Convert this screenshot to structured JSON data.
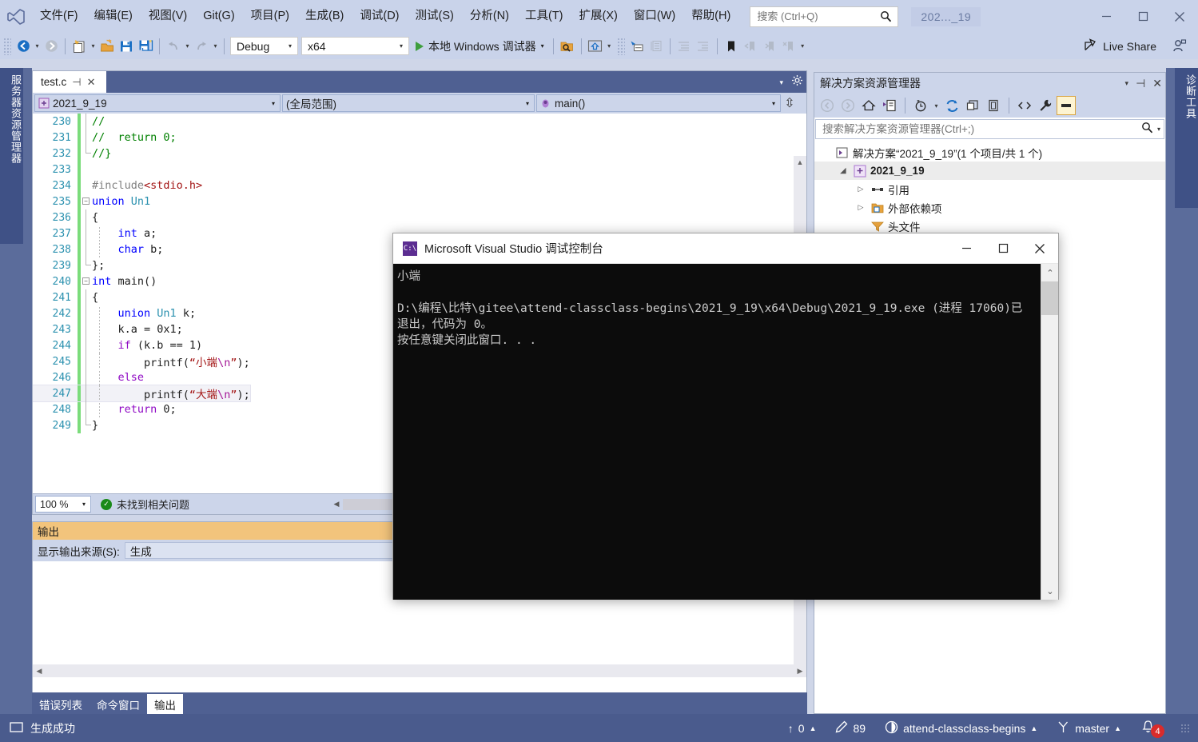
{
  "titlebar": {
    "menu": [
      {
        "label": "文件(F)"
      },
      {
        "label": "编辑(E)"
      },
      {
        "label": "视图(V)"
      },
      {
        "label": "Git(G)"
      },
      {
        "label": "项目(P)"
      },
      {
        "label": "生成(B)"
      },
      {
        "label": "调试(D)"
      },
      {
        "label": "测试(S)"
      },
      {
        "label": "分析(N)"
      },
      {
        "label": "工具(T)"
      },
      {
        "label": "扩展(X)"
      },
      {
        "label": "窗口(W)"
      },
      {
        "label": "帮助(H)"
      }
    ],
    "search_placeholder": "搜索 (Ctrl+Q)",
    "window_name": "202..._19",
    "minimize": "—",
    "maximize": "▢",
    "close": "✕"
  },
  "toolbar": {
    "config": "Debug",
    "platform": "x64",
    "run_label": "本地 Windows 调试器",
    "live_share": "Live Share"
  },
  "left_rail": {
    "label": "服务器资源管理器"
  },
  "right_rail": {
    "label": "诊断工具"
  },
  "editor": {
    "tab_name": "test.c",
    "tab_pin": "⊣",
    "tab_close": "✕",
    "nav_project": "2021_9_19",
    "nav_scope": "(全局范围)",
    "nav_member": "main()",
    "zoom_level": "100 %",
    "issues_status": "未找到相关问题",
    "lines": [
      {
        "n": "230",
        "indent": 1,
        "tokens": [
          {
            "t": "//",
            "c": "c-comment"
          }
        ],
        "guide": "mid"
      },
      {
        "n": "231",
        "indent": 1,
        "tokens": [
          {
            "t": "//  return 0;",
            "c": "c-comment"
          }
        ],
        "guide": "mid"
      },
      {
        "n": "232",
        "indent": 1,
        "tokens": [
          {
            "t": "//}",
            "c": "c-comment"
          }
        ],
        "guide": "end"
      },
      {
        "n": "233",
        "indent": 0,
        "tokens": []
      },
      {
        "n": "234",
        "indent": 1,
        "tokens": [
          {
            "t": "#include",
            "c": "c-pp"
          },
          {
            "t": "<stdio.h>",
            "c": "c-str"
          }
        ]
      },
      {
        "n": "235",
        "indent": 0,
        "fold": "−",
        "tokens": [
          {
            "t": "union ",
            "c": "c-kw"
          },
          {
            "t": "Un1",
            "c": "c-type"
          }
        ]
      },
      {
        "n": "236",
        "indent": 1,
        "tokens": [
          {
            "t": "{",
            "c": "c-plain"
          }
        ],
        "guide": "mid"
      },
      {
        "n": "237",
        "indent": 1,
        "tokens": [
          {
            "t": "    ",
            "c": "c-plain"
          },
          {
            "t": "int",
            "c": "c-kw"
          },
          {
            "t": " a;",
            "c": "c-plain"
          }
        ],
        "guide": "mid",
        "inner": true
      },
      {
        "n": "238",
        "indent": 1,
        "tokens": [
          {
            "t": "    ",
            "c": "c-plain"
          },
          {
            "t": "char",
            "c": "c-kw"
          },
          {
            "t": " b;",
            "c": "c-plain"
          }
        ],
        "guide": "mid",
        "inner": true
      },
      {
        "n": "239",
        "indent": 1,
        "tokens": [
          {
            "t": "};",
            "c": "c-plain"
          }
        ],
        "guide": "end"
      },
      {
        "n": "240",
        "indent": 0,
        "fold": "−",
        "tokens": [
          {
            "t": "int",
            "c": "c-kw"
          },
          {
            "t": " main()",
            "c": "c-plain"
          }
        ]
      },
      {
        "n": "241",
        "indent": 1,
        "tokens": [
          {
            "t": "{",
            "c": "c-plain"
          }
        ],
        "guide": "mid"
      },
      {
        "n": "242",
        "indent": 1,
        "tokens": [
          {
            "t": "    ",
            "c": "c-plain"
          },
          {
            "t": "union",
            "c": "c-kw"
          },
          {
            "t": " ",
            "c": "c-plain"
          },
          {
            "t": "Un1",
            "c": "c-type"
          },
          {
            "t": " k;",
            "c": "c-plain"
          }
        ],
        "guide": "mid",
        "inner": true
      },
      {
        "n": "243",
        "indent": 1,
        "tokens": [
          {
            "t": "    k.a = 0x1;",
            "c": "c-plain"
          }
        ],
        "guide": "mid",
        "inner": true
      },
      {
        "n": "244",
        "indent": 1,
        "tokens": [
          {
            "t": "    ",
            "c": "c-plain"
          },
          {
            "t": "if",
            "c": "c-ctl"
          },
          {
            "t": " (k.b == 1)",
            "c": "c-plain"
          }
        ],
        "guide": "mid",
        "inner": true
      },
      {
        "n": "245",
        "indent": 1,
        "tokens": [
          {
            "t": "        printf(",
            "c": "c-plain"
          },
          {
            "t": "“小端",
            "c": "c-str"
          },
          {
            "t": "\\n",
            "c": "c-esc"
          },
          {
            "t": "”",
            "c": "c-str"
          },
          {
            "t": ");",
            "c": "c-plain"
          }
        ],
        "guide": "mid",
        "inner": true
      },
      {
        "n": "246",
        "indent": 1,
        "tokens": [
          {
            "t": "    ",
            "c": "c-plain"
          },
          {
            "t": "else",
            "c": "c-ctl"
          }
        ],
        "guide": "mid",
        "inner": true
      },
      {
        "n": "247",
        "indent": 1,
        "highlight": true,
        "tokens": [
          {
            "t": "        printf(",
            "c": "c-plain"
          },
          {
            "t": "“大端",
            "c": "c-str"
          },
          {
            "t": "\\n",
            "c": "c-esc"
          },
          {
            "t": "”",
            "c": "c-str"
          },
          {
            "t": ");",
            "c": "c-plain"
          }
        ],
        "guide": "mid",
        "inner": true
      },
      {
        "n": "248",
        "indent": 1,
        "tokens": [
          {
            "t": "    ",
            "c": "c-plain"
          },
          {
            "t": "return",
            "c": "c-ctl"
          },
          {
            "t": " 0;",
            "c": "c-plain"
          }
        ],
        "guide": "mid",
        "inner": true
      },
      {
        "n": "249",
        "indent": 1,
        "tokens": [
          {
            "t": "}",
            "c": "c-plain"
          }
        ],
        "guide": "end"
      }
    ]
  },
  "output": {
    "title": "输出",
    "source_label": "显示输出来源(S):",
    "source_value": "生成",
    "body_text": ""
  },
  "panel_tabs": [
    {
      "label": "错误列表",
      "active": false
    },
    {
      "label": "命令窗口",
      "active": false
    },
    {
      "label": "输出",
      "active": true
    }
  ],
  "solution": {
    "title": "解决方案资源管理器",
    "header_actions": {
      "dropdown": "▾",
      "pin": "⊣",
      "close": "✕"
    },
    "search_placeholder": "搜索解决方案资源管理器(Ctrl+;)",
    "tree": [
      {
        "label": "解决方案“2021_9_19”(1 个项目/共 1 个)",
        "depth": 0,
        "twisty": "",
        "icon": "solution-icon",
        "selected": false
      },
      {
        "label": "2021_9_19",
        "depth": 1,
        "twisty": "◢",
        "icon": "project-icon",
        "selected": true
      },
      {
        "label": "引用",
        "depth": 2,
        "twisty": "▷",
        "icon": "references-icon",
        "selected": false
      },
      {
        "label": "外部依赖项",
        "depth": 2,
        "twisty": "▷",
        "icon": "folder-dep-icon",
        "selected": false
      },
      {
        "label": "头文件",
        "depth": 2,
        "twisty": "",
        "icon": "filter-icon",
        "selected": false
      }
    ]
  },
  "statusbar": {
    "build_status": "生成成功",
    "up_count": "0",
    "pencil_count": "89",
    "repo": "attend-classclass-begins",
    "branch": "master",
    "notification_count": "4"
  },
  "console": {
    "title": "Microsoft Visual Studio 调试控制台",
    "icon_label": "C:\\",
    "minimize": "—",
    "maximize": "▢",
    "close": "✕",
    "output_lines": [
      "小端",
      "",
      "D:\\编程\\比特\\gitee\\attend-classclass-begins\\2021_9_19\\x64\\Debug\\2021_9_19.exe (进程 17060)已退出，代码为 0。",
      "按任意键关闭此窗口. . ."
    ]
  },
  "colors": {
    "chrome": "#c9d3ea",
    "accent_blue": "#4a5b8d",
    "tab_strip": "#4f6092",
    "output_title": "#f2c47c",
    "console_bg": "#0c0c0c",
    "status_bar": "#4a5b8d"
  }
}
